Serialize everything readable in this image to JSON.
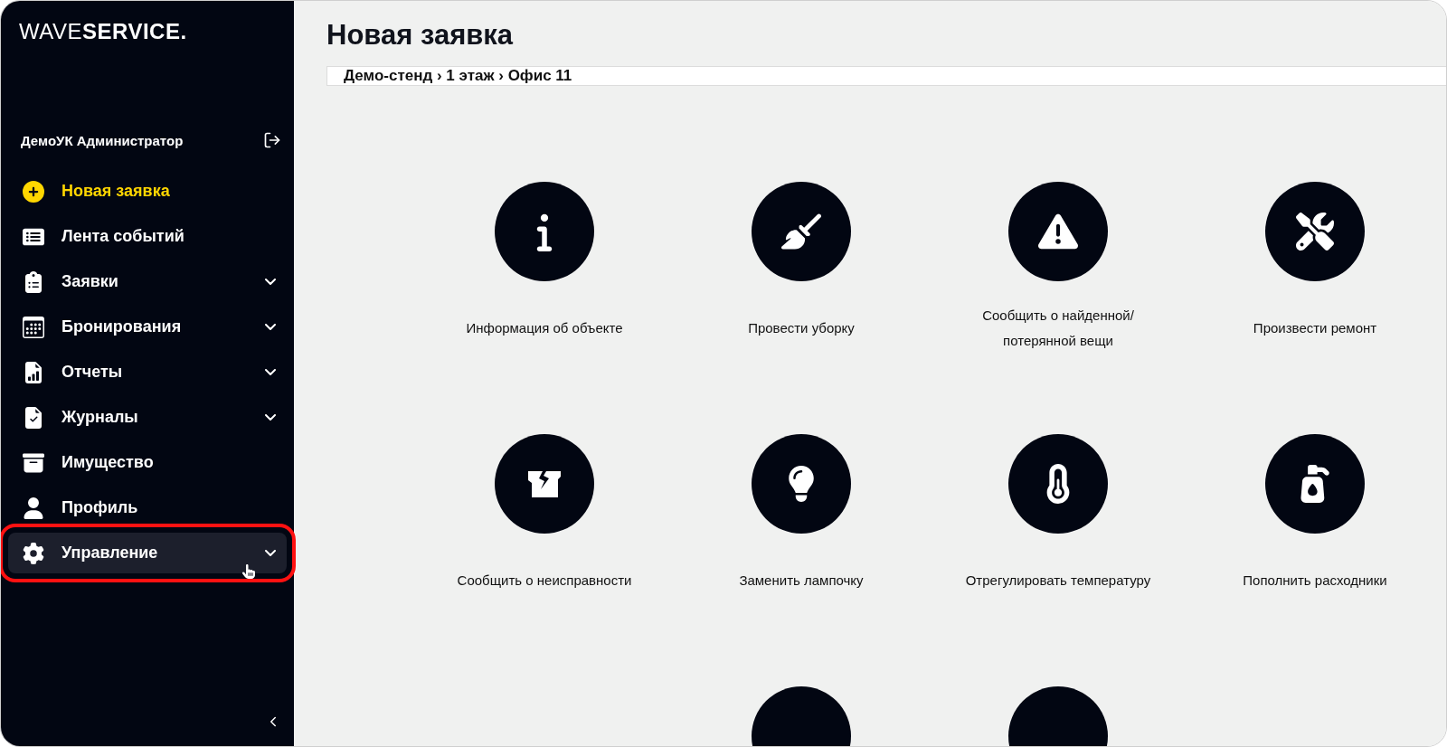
{
  "sidebar": {
    "logo": "WAVE**SERVICE.**",
    "user": "ДемоУК Администратор",
    "items": [
      {
        "label": "Новая заявка",
        "selected": true,
        "expandable": false,
        "hovered": false,
        "highlighted": false
      },
      {
        "label": "Лента событий",
        "selected": false,
        "expandable": false,
        "hovered": false,
        "highlighted": false
      },
      {
        "label": "Заявки",
        "selected": false,
        "expandable": true,
        "hovered": false,
        "highlighted": false
      },
      {
        "label": "Бронирования",
        "selected": false,
        "expandable": true,
        "hovered": false,
        "highlighted": false
      },
      {
        "label": "Отчеты",
        "selected": false,
        "expandable": true,
        "hovered": false,
        "highlighted": false
      },
      {
        "label": "Журналы",
        "selected": false,
        "expandable": true,
        "hovered": false,
        "highlighted": false
      },
      {
        "label": "Имущество",
        "selected": false,
        "expandable": false,
        "hovered": false,
        "highlighted": false
      },
      {
        "label": "Профиль",
        "selected": false,
        "expandable": false,
        "hovered": false,
        "highlighted": false
      },
      {
        "label": "Управление",
        "selected": false,
        "expandable": true,
        "hovered": true,
        "highlighted": true
      }
    ]
  },
  "page": {
    "title": "Новая заявка",
    "breadcrumb": "Демо-стенд › 1 этаж › Офис 11",
    "tiles": [
      {
        "label": "Информация об объекте"
      },
      {
        "label": "Провести уборку"
      },
      {
        "label": "Сообщить о найденной/ потерянной вещи"
      },
      {
        "label": "Произвести ремонт"
      },
      {
        "label": "Сообщить о неисправности"
      },
      {
        "label": "Заменить лампочку"
      },
      {
        "label": "Отрегулировать температуру"
      },
      {
        "label": "Пополнить расходники"
      }
    ]
  }
}
